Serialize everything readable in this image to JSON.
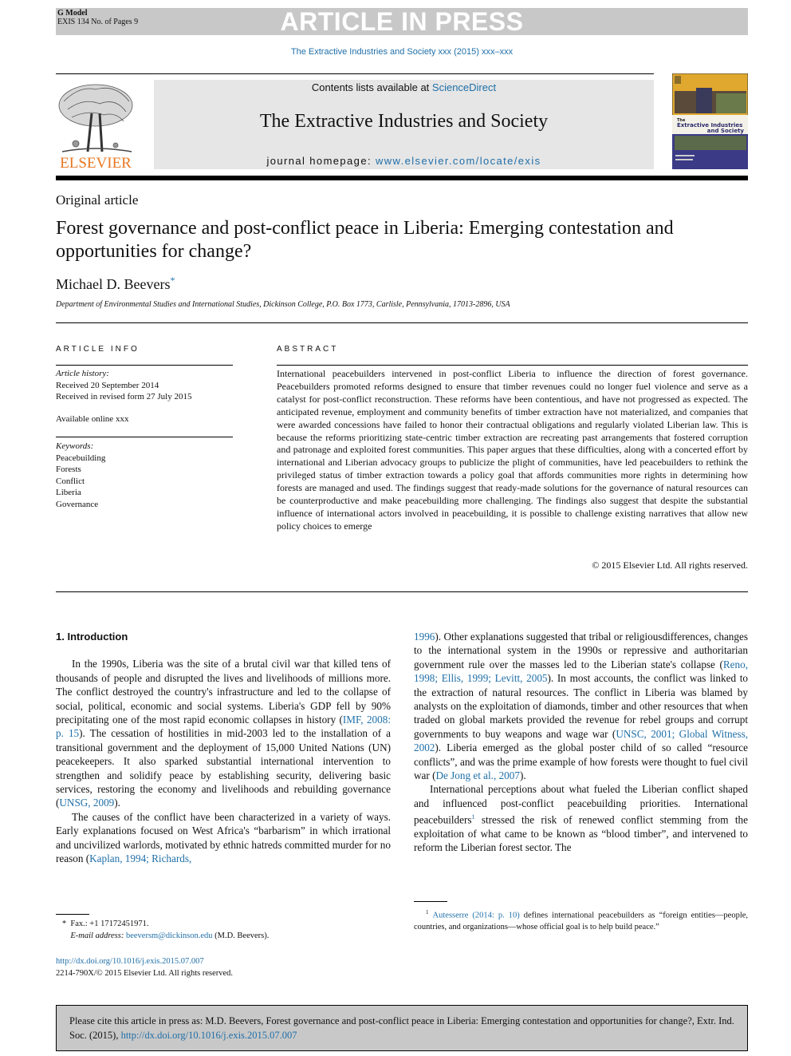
{
  "banner": {
    "gmodel": "G Model",
    "ref": "EXIS 134 No. of Pages 9",
    "label": "ARTICLE IN PRESS"
  },
  "journal_citation_line": "The Extractive Industries and Society xxx (2015) xxx–xxx",
  "masthead": {
    "publisher": "ELSEVIER",
    "contents_prefix": "Contents lists available at ",
    "contents_link": "ScienceDirect",
    "journal_title": "The Extractive Industries and Society",
    "homepage_prefix": "journal homepage: ",
    "homepage_link": "www.elsevier.com/locate/exis",
    "cover": {
      "line1": "The",
      "line2": "Extractive Industries",
      "line3": "and Society"
    }
  },
  "article": {
    "type": "Original article",
    "title": "Forest governance and post-conflict peace in Liberia: Emerging contestation and opportunities for change?",
    "author": "Michael D. Beevers",
    "author_mark": "*",
    "affiliation": "Department of Environmental Studies and International Studies, Dickinson College, P.O. Box 1773, Carlisle, Pennsylvania, 17013-2896, USA"
  },
  "article_info": {
    "heading": "ARTICLE INFO",
    "history_label": "Article history:",
    "received": "Received 20 September 2014",
    "revised": "Received in revised form 27 July 2015",
    "available": "Available online xxx",
    "keywords_label": "Keywords:",
    "keywords": [
      "Peacebuilding",
      "Forests",
      "Conflict",
      "Liberia",
      "Governance"
    ]
  },
  "abstract": {
    "heading": "ABSTRACT",
    "text": "International peacebuilders intervened in post-conflict Liberia to influence the direction of forest governance. Peacebuilders promoted reforms designed to ensure that timber revenues could no longer fuel violence and serve as a catalyst for post-conflict reconstruction. These reforms have been contentious, and have not progressed as expected. The anticipated revenue, employment and community benefits of timber extraction have not materialized, and companies that were awarded concessions have failed to honor their contractual obligations and regularly violated Liberian law. This is because the reforms prioritizing state-centric timber extraction are recreating past arrangements that fostered corruption and patronage and exploited forest communities. This paper argues that these difficulties, along with a concerted effort by international and Liberian advocacy groups to publicize the plight of communities, have led peacebuilders to rethink the privileged status of timber extraction towards a policy goal that affords communities more rights in determining how forests are managed and used. The findings suggest that ready-made solutions for the governance of natural resources can be counterproductive and make peacebuilding more challenging. The findings also suggest that despite the substantial influence of international actors involved in peacebuilding, it is possible to challenge existing narratives that allow new policy choices to emerge",
    "copyright": "© 2015 Elsevier Ltd. All rights reserved."
  },
  "intro": {
    "heading": "1. Introduction",
    "p1": {
      "t1": "In the 1990s, Liberia was the site of a brutal civil war that killed tens of thousands of people and disrupted the lives and livelihoods of millions more. The conflict destroyed the country's infrastructure and led to the collapse of social, political, economic and social systems. Liberia's GDP fell by 90% precipitating one of the most rapid economic collapses in history (",
      "c1": "IMF, 2008: p. 15",
      "t2": "). The cessation of hostilities in mid-2003 led to the installation of a transitional government and the deployment of 15,000 United Nations (UN) peacekeepers. It also sparked substantial international intervention to strengthen and solidify peace by establishing security, delivering basic services, restoring the economy and livelihoods and rebuilding governance (",
      "c2": "UNSG, 2009",
      "t3": ")."
    },
    "p2": {
      "t1": "The causes of the conflict have been characterized in a variety of ways. Early explanations focused on West Africa's “barbarism” in which irrational and uncivilized warlords, motivated by ethnic hatreds committed murder for no reason (",
      "c1": "Kaplan, 1994; Richards,",
      "c1b": "1996",
      "t2": "). Other explanations suggested that tribal or religiousdifferences, changes to the international system in the 1990s or repressive and authoritarian government rule over the masses led to the Liberian state's collapse (",
      "c2": "Reno, 1998; Ellis, 1999; Levitt, 2005",
      "t3": "). In most accounts, the conflict was linked to the extraction of natural resources. The conflict in Liberia was blamed by analysts on the exploitation of diamonds, timber and other resources that when traded on global markets provided the revenue for rebel groups and corrupt governments to buy weapons and wage war (",
      "c3": "UNSC, 2001; Global Witness, 2002",
      "t4": "). Liberia emerged as the global poster child of so called “resource conflicts”, and was the prime example of how forests were thought to fuel civil war (",
      "c4": "De Jong et al., 2007",
      "t5": ")."
    },
    "p3": {
      "t1": "International perceptions about what fueled the Liberian conflict shaped and influenced post-conflict peacebuilding priorities. International peacebuilders",
      "fn": "1",
      "t2": " stressed the risk of renewed conflict stemming from the exploitation of what came to be known as “blood timber”, and intervened to reform the Liberian forest sector. The"
    }
  },
  "footnotes": {
    "author_mark": "*",
    "fax": "Fax.: +1 17172451971.",
    "email_label": "E-mail address: ",
    "email": "beeversm@dickinson.edu",
    "email_suffix": " (M.D.  Beevers).",
    "fn1_mark": "1",
    "fn1_cite": "Autesserre (2014: p. 10)",
    "fn1_text": " defines international peacebuilders as “foreign entities—people, countries, and organizations—whose official goal is to help build peace.”"
  },
  "doi": {
    "link": "http://dx.doi.org/10.1016/j.exis.2015.07.007",
    "issn": "2214-790X/© 2015 Elsevier Ltd. All rights reserved."
  },
  "cite_box": {
    "text": "Please cite this article in press as: M.D. Beevers, Forest governance and post-conflict peace in Liberia: Emerging contestation and opportunities for change?, Extr. Ind. Soc. (2015), ",
    "link": "http://dx.doi.org/10.1016/j.exis.2015.07.007"
  }
}
